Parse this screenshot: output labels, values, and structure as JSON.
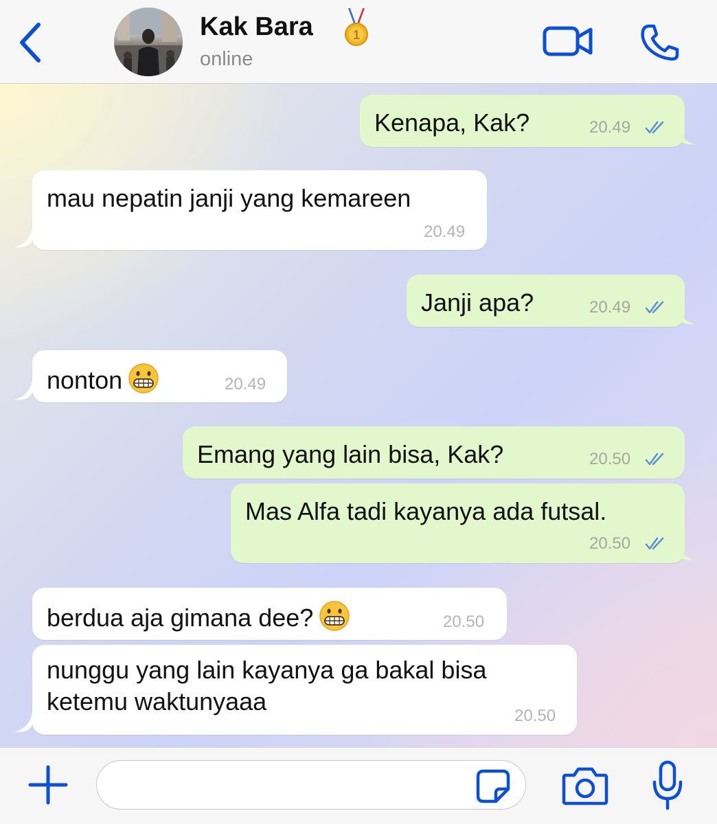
{
  "header": {
    "contact_name": "Kak Bara",
    "status": "online",
    "badge_emoji": "1st-place-medal",
    "accent_color": "#0a4fd6"
  },
  "messages": [
    {
      "direction": "outgoing",
      "text": "Kenapa, Kak?",
      "time": "20.49",
      "status": "read"
    },
    {
      "direction": "incoming",
      "text": "mau nepatin janji yang kemareen",
      "time": "20.49"
    },
    {
      "direction": "outgoing",
      "text": "Janji apa?",
      "time": "20.49",
      "status": "read"
    },
    {
      "direction": "incoming",
      "text": "nonton",
      "emoji": "grimacing-face",
      "time": "20.49"
    },
    {
      "direction": "outgoing",
      "text": "Emang yang lain bisa, Kak?",
      "time": "20.50",
      "status": "read"
    },
    {
      "direction": "outgoing",
      "text": "Mas Alfa tadi kayanya ada futsal.",
      "time": "20.50",
      "status": "read"
    },
    {
      "direction": "incoming",
      "text": "berdua aja gimana dee?",
      "emoji": "grimacing-face",
      "time": "20.50"
    },
    {
      "direction": "incoming",
      "text_line1": "nunggu yang lain kayanya ga bakal bisa",
      "text_line2": "ketemu waktunyaaa",
      "time": "20.50"
    }
  ],
  "input": {
    "value": "",
    "placeholder": ""
  },
  "colors": {
    "outgoing_bubble": "#e2f7cb",
    "incoming_bubble": "#ffffff",
    "read_ticks": "#5b8fd6"
  }
}
